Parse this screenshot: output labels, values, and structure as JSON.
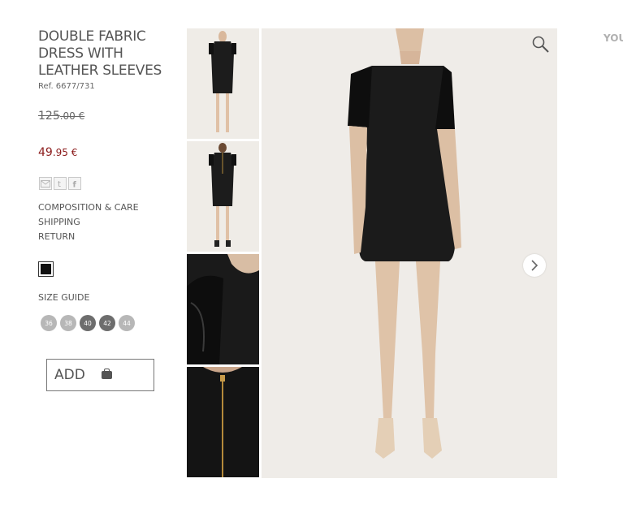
{
  "product": {
    "title": "DOUBLE FABRIC DRESS WITH LEATHER SLEEVES",
    "ref": "Ref. 6677/731"
  },
  "price": {
    "old_int": "125",
    "old_dec": ".00 €",
    "new_int": "49",
    "new_dec": ".95 €"
  },
  "share": [
    "email-icon",
    "twitter-icon",
    "facebook-icon"
  ],
  "links": {
    "composition": "COMPOSITION & CARE",
    "shipping": "SHIPPING",
    "return": "RETURN"
  },
  "color_swatch": "#111111",
  "size_guide_label": "SIZE GUIDE",
  "sizes": [
    {
      "label": "36",
      "available": false
    },
    {
      "label": "38",
      "available": false
    },
    {
      "label": "40",
      "available": true
    },
    {
      "label": "42",
      "available": true
    },
    {
      "label": "44",
      "available": false
    }
  ],
  "add_button": {
    "label": "ADD"
  },
  "header_right": "YOU",
  "colors": {
    "price_red": "#8b1a1a",
    "background": "#ffffff",
    "photo_bg": "#efece8"
  }
}
